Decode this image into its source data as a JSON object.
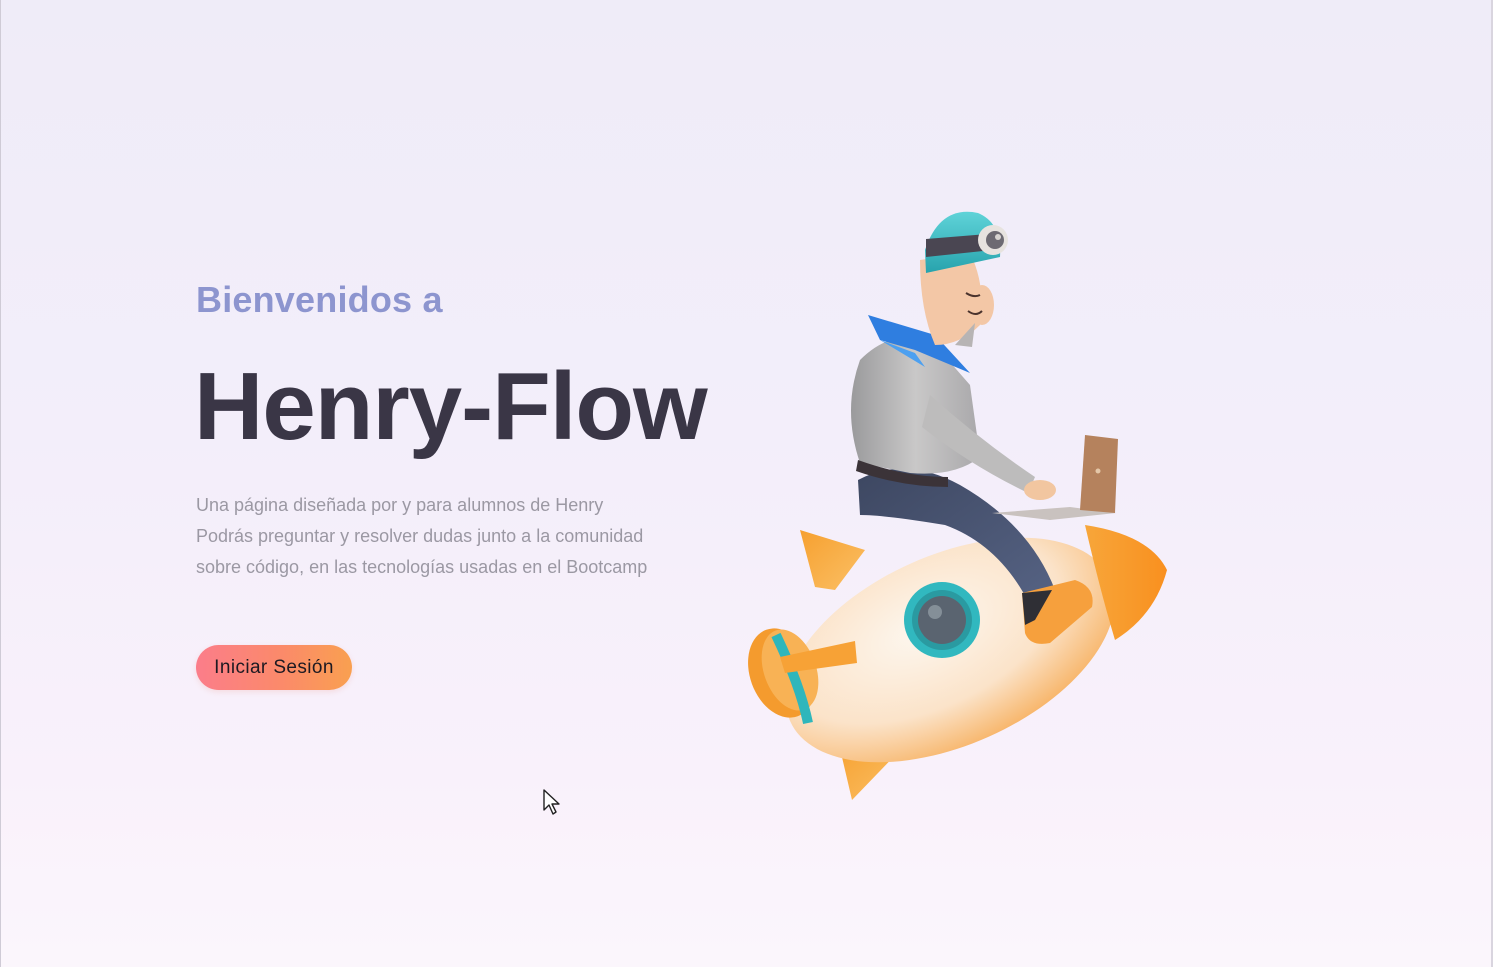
{
  "hero": {
    "eyebrow": "Bienvenidos a",
    "title": "Henry-Flow",
    "description_lines": [
      "Una página diseñada por y para alumnos de Henry",
      "Podrás preguntar y resolver dudas junto a la comunidad",
      "sobre código, en las tecnologías usadas en el Bootcamp"
    ],
    "login_label": "Iniciar Sesión"
  },
  "illustration": {
    "icon": "rocket-rider-illustration"
  },
  "colors": {
    "accent_eyebrow": "#8d95cf",
    "title": "#3a3646",
    "button_gradient_start": "#fb7d8a",
    "button_gradient_end": "#f9a050"
  }
}
